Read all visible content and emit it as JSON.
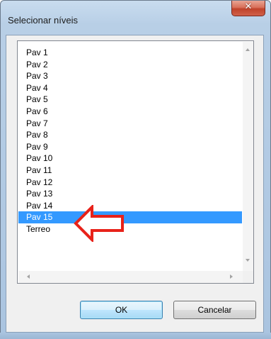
{
  "window": {
    "title": "Selecionar níveis",
    "close_glyph": "✕"
  },
  "list": {
    "items": [
      "Pav 1",
      "Pav 2",
      "Pav 3",
      "Pav 4",
      "Pav 5",
      "Pav 6",
      "Pav 7",
      "Pav 8",
      "Pav 9",
      "Pav 10",
      "Pav 11",
      "Pav 12",
      "Pav 13",
      "Pav 14",
      "Pav 15",
      "Terreo"
    ],
    "selected_index": 14,
    "selected_label": "Pav 15"
  },
  "buttons": {
    "ok_label": "OK",
    "cancel_label": "Cancelar"
  },
  "colors": {
    "selection": "#3399ff",
    "annotation_arrow": "#e8221a"
  },
  "icons": {
    "close": "close-icon",
    "scroll_up": "chevron-up-icon",
    "scroll_down": "chevron-down-icon",
    "scroll_left": "chevron-left-icon",
    "scroll_right": "chevron-right-icon",
    "annotation": "arrow-left-icon"
  }
}
